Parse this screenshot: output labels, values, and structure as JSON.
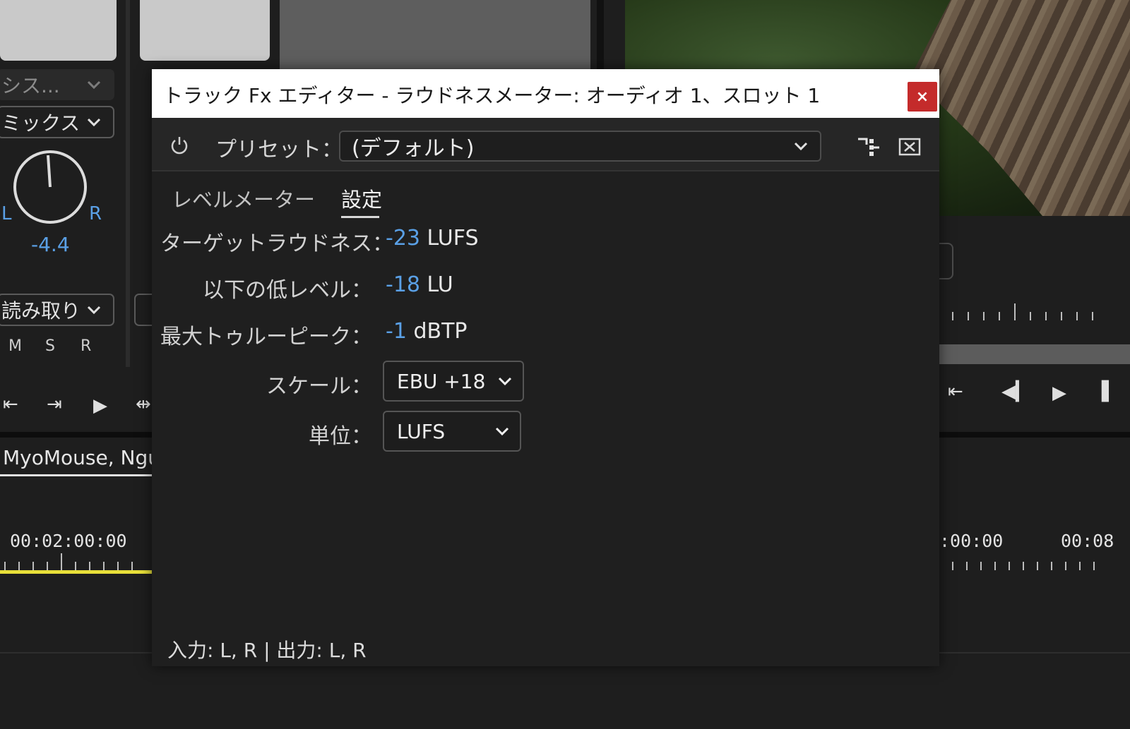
{
  "background": {
    "mixer": {
      "dropdown1_text": "シス...",
      "dropdown2_text": "ミックス",
      "pan_left": "L",
      "pan_right": "R",
      "pan_value": "-4.4",
      "automation_text": "読み取り",
      "mute": "M",
      "solo": "S",
      "record": "R"
    },
    "clip_label": "MyoMouse, Ngu",
    "timecode_left": "00:02:00:00",
    "timecode_right1": ":00:00",
    "timecode_right2": "00:08"
  },
  "dialog": {
    "title": "トラック Fx エディター - ラウドネスメーター: オーディオ 1、スロット 1",
    "close_label": "×",
    "preset_label": "プリセット：",
    "preset_value": "(デフォルト)",
    "tabs": [
      {
        "label": "レベルメーター",
        "active": false
      },
      {
        "label": "設定",
        "active": true
      }
    ],
    "settings": {
      "target_label": "ターゲットラウドネス：",
      "target_value": "-23",
      "target_unit": "LUFS",
      "low_label": "以下の低レベル：",
      "low_value": "-18",
      "low_unit": "LU",
      "peak_label": "最大トゥルーピーク：",
      "peak_value": "-1",
      "peak_unit": "dBTP",
      "scale_label": "スケール：",
      "scale_value": "EBU +18",
      "unit_label": "単位：",
      "unit_value": "LUFS"
    },
    "footer": "入力: L, R | 出力: L, R"
  },
  "colors": {
    "accent_value": "#5aa0e6",
    "close_button": "#c42b2b",
    "playhead_line": "#e8e03a"
  }
}
